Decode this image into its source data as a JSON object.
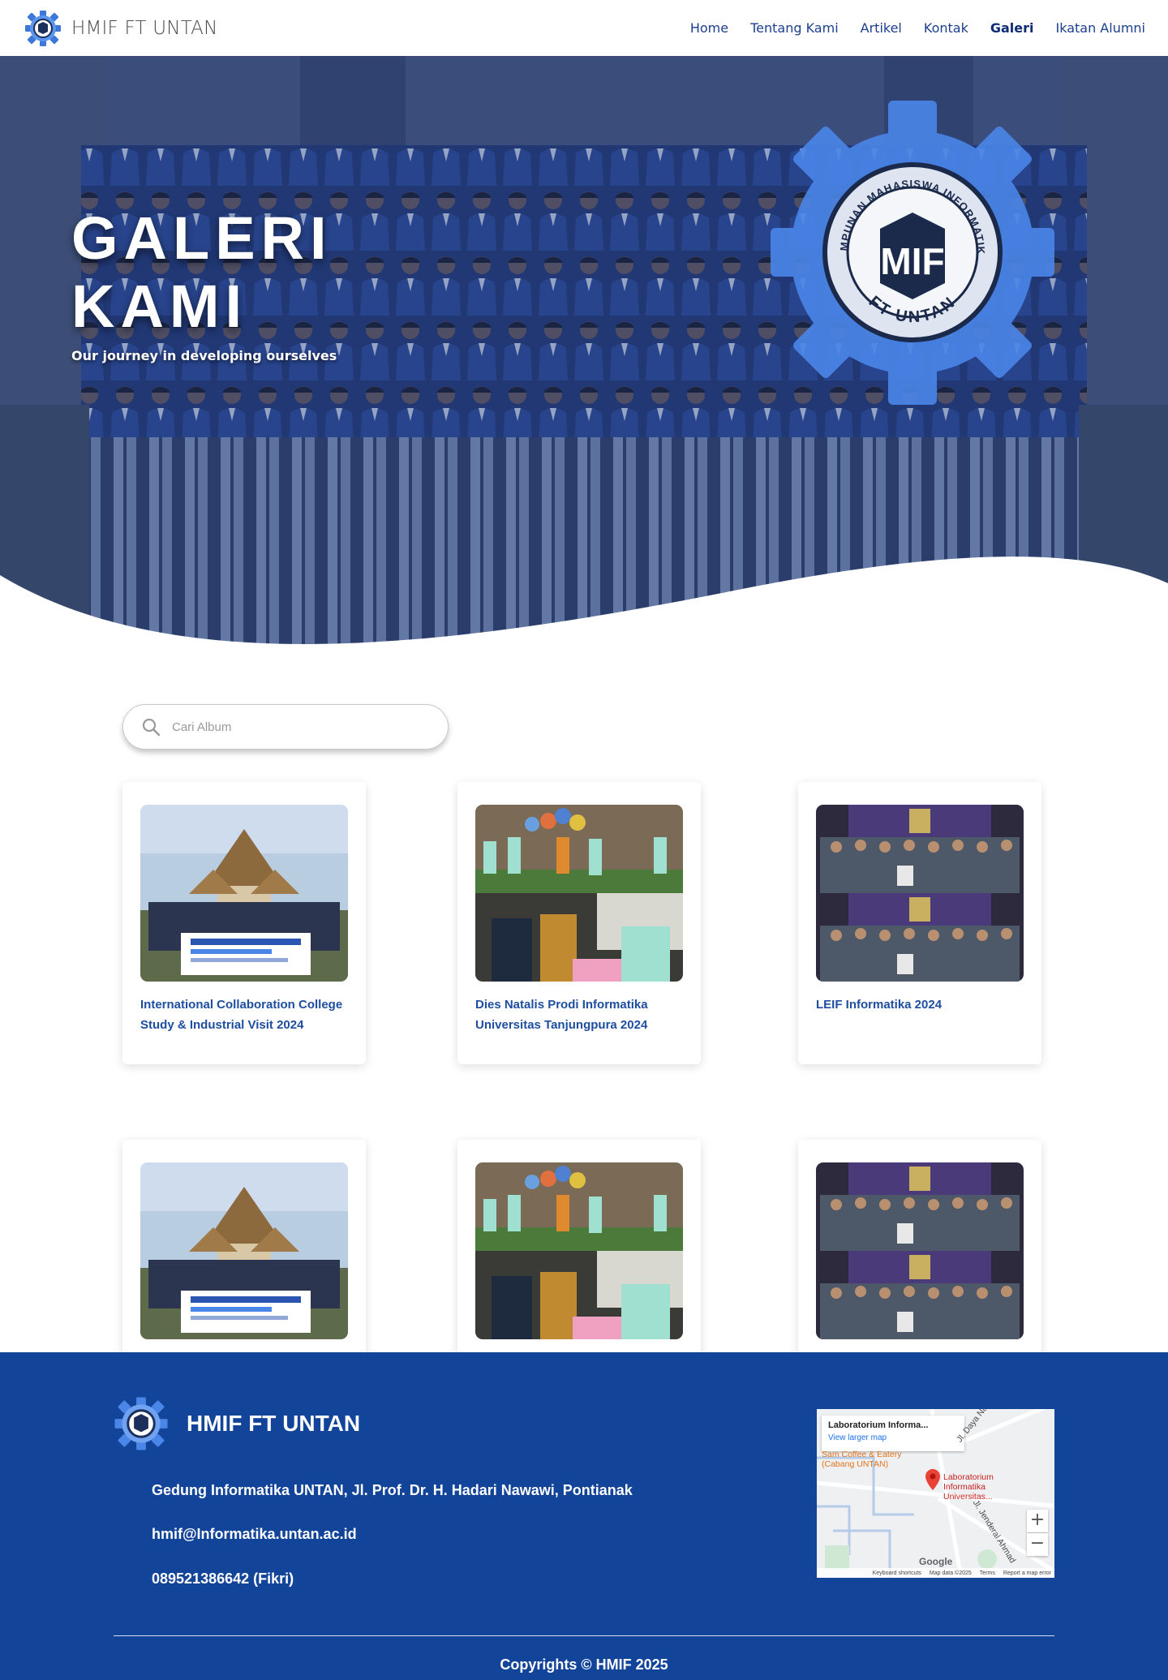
{
  "brand": {
    "name": "HMIF FT UNTAN"
  },
  "nav": {
    "items": [
      {
        "label": "Home",
        "active": false
      },
      {
        "label": "Tentang Kami",
        "active": false
      },
      {
        "label": "Artikel",
        "active": false
      },
      {
        "label": "Kontak",
        "active": false
      },
      {
        "label": "Galeri",
        "active": true
      },
      {
        "label": "Ikatan Alumni",
        "active": false
      }
    ]
  },
  "hero": {
    "title": "GALERI\nKAMI",
    "subtitle": "Our journey in developing ourselves",
    "emblem_top_text": "HIMPUNAN MAHASISWA INFORMATIKA",
    "emblem_bottom_text": "FT-UNTAN",
    "emblem_mark": "MIF"
  },
  "search": {
    "placeholder": "Cari Album",
    "value": ""
  },
  "albums": [
    {
      "title": "International Collaboration College Study & Industrial Visit 2024",
      "image": "building-group-photo"
    },
    {
      "title": "Dies Natalis Prodi Informatika Universitas Tanjungpura 2024",
      "image": "event-collage-photo"
    },
    {
      "title": "LEIF Informatika 2024",
      "image": "stage-group-photo"
    },
    {
      "title": "",
      "image": "building-group-photo"
    },
    {
      "title": "",
      "image": "event-collage-photo"
    },
    {
      "title": "",
      "image": "stage-group-photo"
    }
  ],
  "footer": {
    "title": "HMIF FT UNTAN",
    "address": "Gedung Informatika UNTAN, Jl. Prof. Dr. H. Hadari Nawawi, Pontianak",
    "email": "hmif@Informatika.untan.ac.id",
    "phone": "089521386642 (Fikri)",
    "copyright": "Copyrights © HMIF 2025"
  },
  "map": {
    "place_title": "Laboratorium Informa...",
    "larger_map_link": "View larger map",
    "pin_label": "Laboratorium Informatika Universitas...",
    "poi_label": "Sam Coffee & Eatery (Cabang UNTAN)",
    "road_1": "Jl. Daya Nasional",
    "road_2": "Jl. Jenderal Ahmad",
    "zoom_in": "+",
    "zoom_out": "−",
    "footer_items": [
      "Keyboard shortcuts",
      "Map data ©2025",
      "Terms",
      "Report a map error"
    ],
    "google": "Google"
  },
  "colors": {
    "primary": "#12449a",
    "nav_text": "#1d3f8f",
    "card_title": "#1e4ea0",
    "emblem_blue": "#4a86e8"
  }
}
